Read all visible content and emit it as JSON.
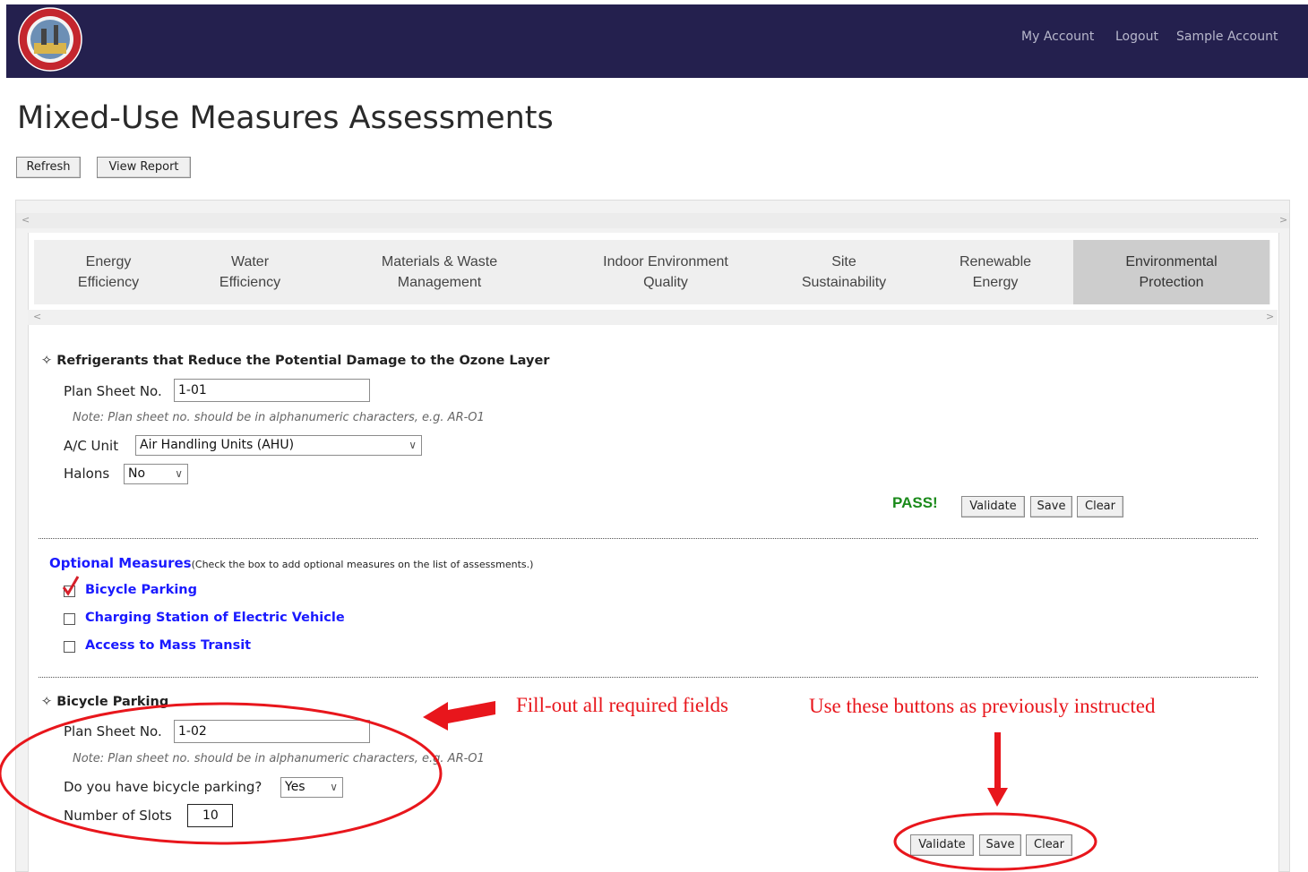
{
  "header": {
    "logo_text": "CITY OF MANDALUYONG",
    "links": [
      "My Account",
      "Logout",
      "Sample Account"
    ]
  },
  "page": {
    "title": "Mixed-Use Measures Assessments",
    "refresh_label": "Refresh",
    "view_report_label": "View Report"
  },
  "tabs": [
    {
      "line1": "Energy",
      "line2": "Efficiency"
    },
    {
      "line1": "Water",
      "line2": "Efficiency"
    },
    {
      "line1": "Materials & Waste",
      "line2": "Management"
    },
    {
      "line1": "Indoor Environment",
      "line2": "Quality"
    },
    {
      "line1": "Site",
      "line2": "Sustainability"
    },
    {
      "line1": "Renewable",
      "line2": "Energy"
    },
    {
      "line1": "Environmental",
      "line2": "Protection"
    }
  ],
  "section1": {
    "title": "Refrigerants that Reduce the Potential Damage to the Ozone Layer",
    "plan_label": "Plan Sheet No.",
    "plan_value": "1-01",
    "note": "Note: Plan sheet no. should be in alphanumeric characters, e.g. AR-O1",
    "ac_label": "A/C Unit",
    "ac_value": "Air Handling Units (AHU)",
    "halons_label": "Halons",
    "halons_value": "No",
    "status": "PASS!",
    "validate": "Validate",
    "save": "Save",
    "clear": "Clear"
  },
  "optional": {
    "heading": "Optional Measures",
    "hint": "(Check the box to add optional measures on the list of assessments.)",
    "items": [
      {
        "label": "Bicycle Parking",
        "checked": true
      },
      {
        "label": "Charging Station of Electric Vehicle",
        "checked": false
      },
      {
        "label": "Access to Mass Transit",
        "checked": false
      }
    ]
  },
  "section2": {
    "title": "Bicycle Parking",
    "plan_label": "Plan Sheet No.",
    "plan_value": "1-02",
    "note": "Note: Plan sheet no. should be in alphanumeric characters, e.g. AR-O1",
    "q_label": "Do you have bicycle parking?",
    "q_value": "Yes",
    "slots_label": "Number of Slots",
    "slots_value": "10",
    "validate": "Validate",
    "save": "Save",
    "clear": "Clear"
  },
  "annotations": {
    "fill_text": "Fill-out all required fields",
    "buttons_text": "Use these buttons as previously instructed",
    "color": "#e8161c"
  },
  "colors": {
    "header_bg": "#24204e",
    "pass": "#1a8a1a",
    "optional_link": "#1a1aff"
  }
}
